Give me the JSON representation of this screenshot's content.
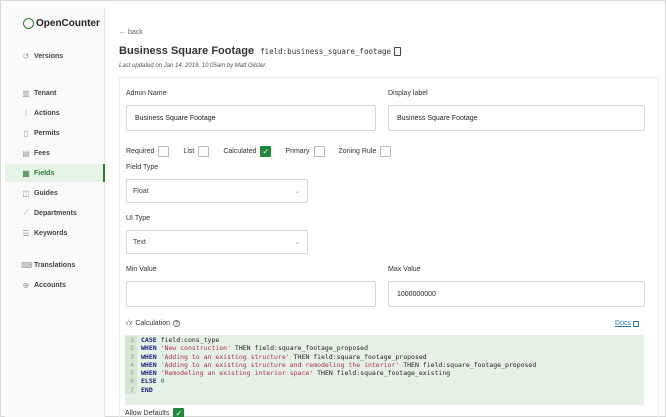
{
  "app": {
    "name": "OpenCounter"
  },
  "sidebar": {
    "items": [
      {
        "label": "Versions",
        "icon": "history-icon"
      },
      {
        "label": "Tenant",
        "icon": "building-icon"
      },
      {
        "label": "Actions",
        "icon": "actions-icon"
      },
      {
        "label": "Permits",
        "icon": "document-icon"
      },
      {
        "label": "Fees",
        "icon": "receipt-icon"
      },
      {
        "label": "Fields",
        "icon": "table-icon",
        "active": true
      },
      {
        "label": "Guides",
        "icon": "book-icon"
      },
      {
        "label": "Departments",
        "icon": "leaf-icon"
      },
      {
        "label": "Keywords",
        "icon": "list-icon"
      },
      {
        "label": "Translations",
        "icon": "keyboard-icon"
      },
      {
        "label": "Accounts",
        "icon": "globe-icon"
      }
    ]
  },
  "header": {
    "back_label": "← back",
    "title": "Business Square Footage",
    "field_code": "field:business_square_footage",
    "updated": "Last updated on Jan 14, 2019, 10:05am by Matt Gilster."
  },
  "form": {
    "admin_name_label": "Admin Name",
    "admin_name_value": "Business Square Footage",
    "display_label_label": "Display label",
    "display_label_value": "Business Square Footage",
    "checkboxes": [
      {
        "label": "Required",
        "checked": false
      },
      {
        "label": "List",
        "checked": false
      },
      {
        "label": "Calculated",
        "checked": true
      },
      {
        "label": "Primary",
        "checked": false
      },
      {
        "label": "Zoning Rule",
        "checked": false
      }
    ],
    "field_type_label": "Field Type",
    "field_type_value": "Float",
    "ui_type_label": "UI Type",
    "ui_type_value": "Text",
    "min_value_label": "Min Value",
    "min_value_value": "",
    "max_value_label": "Max Value",
    "max_value_value": "1000000000",
    "calculation_label": "Calculation",
    "docs_label": "Docs",
    "allow_defaults_label": "Allow Defaults"
  },
  "code": {
    "lines": [
      {
        "n": "1",
        "kw": "CASE",
        "str": "",
        "rest": " field:cons_type"
      },
      {
        "n": "2",
        "kw": "WHEN",
        "str": " 'New construction'",
        "rest": " THEN field:square_footage_proposed"
      },
      {
        "n": "3",
        "kw": "WHEN",
        "str": " 'Adding to an existing structure'",
        "rest": " THEN field:square_footage_proposed"
      },
      {
        "n": "4",
        "kw": "WHEN",
        "str": " 'Adding to an existing structure and remodeling the interior'",
        "rest": " THEN field:square_footage_proposed"
      },
      {
        "n": "5",
        "kw": "WHEN",
        "str": " 'Remodeling an existing interior space'",
        "rest": " THEN field:square_footage_existing"
      },
      {
        "n": "6",
        "kw": "ELSE",
        "str": "",
        "rest": "",
        "num": " 0"
      },
      {
        "n": "7",
        "kw": "END",
        "str": "",
        "rest": ""
      }
    ]
  },
  "colors": {
    "accent": "#2e7d32",
    "check": "#1f8a3b",
    "code_bg": "#e4f1e4",
    "link": "#2a7ab0"
  }
}
